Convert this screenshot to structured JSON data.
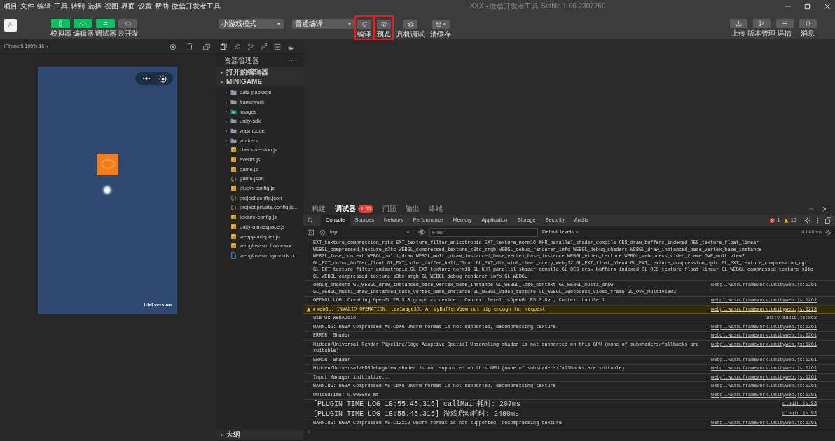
{
  "menu": [
    "项目",
    "文件",
    "编辑",
    "工具",
    "转到",
    "选择",
    "视图",
    "界面",
    "设置",
    "帮助",
    "微信开发者工具"
  ],
  "window": {
    "title": "XXX - 微信开发者工具 Stable 1.06.2307260"
  },
  "toolbar": {
    "view_buttons": [
      {
        "label": "模拟器",
        "kind": "phone",
        "on": true
      },
      {
        "label": "编辑器",
        "kind": "code",
        "on": true
      },
      {
        "label": "调试器",
        "kind": "swap",
        "on": true
      },
      {
        "label": "云开发",
        "kind": "cloud",
        "on": false
      }
    ],
    "mode_select": "小游戏模式",
    "compile_select": "普通编译",
    "actions": [
      {
        "label": "编译",
        "kind": "refresh",
        "highlighted": true
      },
      {
        "label": "预览",
        "kind": "eye",
        "highlighted": true
      },
      {
        "label": "真机调试",
        "kind": "bug",
        "highlighted": false
      },
      {
        "label": "清缓存",
        "kind": "layers",
        "highlighted": false
      }
    ],
    "right_buttons": [
      {
        "label": "上传",
        "kind": "upload"
      },
      {
        "label": "版本管理",
        "kind": "branch"
      },
      {
        "label": "详情",
        "kind": "list"
      },
      {
        "label": "消息",
        "kind": "bell"
      }
    ]
  },
  "simulator": {
    "device": "iPhone 5 100% 16",
    "badge": "trial version"
  },
  "explorer": {
    "title": "资源管理器",
    "more": "···",
    "open_editors": {
      "label": "打开的编辑器",
      "expanded": false
    },
    "project": {
      "label": "MINIGAME",
      "expanded": true,
      "items": [
        {
          "name": "data-package",
          "kind": "folder",
          "expanded": false
        },
        {
          "name": "framework",
          "kind": "folder",
          "expanded": false
        },
        {
          "name": "images",
          "kind": "image-folder",
          "expanded": false
        },
        {
          "name": "unity-sdk",
          "kind": "folder",
          "expanded": false
        },
        {
          "name": "wasmcode",
          "kind": "folder",
          "expanded": false
        },
        {
          "name": "workers",
          "kind": "folder",
          "expanded": false
        },
        {
          "name": "check-version.js",
          "kind": "js"
        },
        {
          "name": "events.js",
          "kind": "js"
        },
        {
          "name": "game.js",
          "kind": "js"
        },
        {
          "name": "game.json",
          "kind": "json"
        },
        {
          "name": "plugin-config.js",
          "kind": "js"
        },
        {
          "name": "project.config.json",
          "kind": "json"
        },
        {
          "name": "project.private.config.js...",
          "kind": "json"
        },
        {
          "name": "texture-config.js",
          "kind": "js"
        },
        {
          "name": "unity-namespace.js",
          "kind": "js"
        },
        {
          "name": "weapp-adapter.js",
          "kind": "js"
        },
        {
          "name": "webgl.wasm.framewor...",
          "kind": "js"
        },
        {
          "name": "webgl.wasm.symbols.u...",
          "kind": "file"
        }
      ]
    },
    "outline": {
      "label": "大纲",
      "expanded": false
    }
  },
  "devtools": {
    "tabs": [
      {
        "label": "构建",
        "selected": false
      },
      {
        "label": "调试器",
        "selected": true,
        "badge": "1, 15"
      },
      {
        "label": "问题",
        "selected": false
      },
      {
        "label": "输出",
        "selected": false
      },
      {
        "label": "终端",
        "selected": false
      }
    ],
    "panels": [
      {
        "label": "Console",
        "selected": true
      },
      {
        "label": "Sources",
        "selected": false
      },
      {
        "label": "Network",
        "selected": false
      },
      {
        "label": "Performance",
        "selected": false
      },
      {
        "label": "Memory",
        "selected": false
      },
      {
        "label": "Application",
        "selected": false
      },
      {
        "label": "Storage",
        "selected": false
      },
      {
        "label": "Security",
        "selected": false
      },
      {
        "label": "Audits",
        "selected": false
      }
    ],
    "errors": "1",
    "warnings": "15",
    "context": "top",
    "filter_placeholder": "Filter",
    "levels": "Default levels",
    "hidden": "4 hidden",
    "logs": [
      {
        "kind": "log",
        "lines": [
          "EXT_texture_compression_rgtc EXT_texture_filter_anisotropic EXT_texture_norm16 KHR_parallel_shader_compile OES_draw_buffers_indexed OES_texture_float_linear",
          "WEBGL_compressed_texture_s3tc WEBGL_compressed_texture_s3tc_srgb WEBGL_debug_renderer_info WEBGL_debug_shaders WEBGL_draw_instanced_base_vertex_base_instance",
          "WEBGL_lose_context WEBGL_multi_draw WEBGL_multi_draw_instanced_base_vertex_base_instance WEBGL_video_texture WEBGL_webcodecs_video_frame OVR_multiview2",
          "GL_EXT_color_buffer_float GL_EXT_color_buffer_half_float GL_EXT_disjoint_timer_query_webgl2 GL_EXT_float_blend GL_EXT_texture_compression_bptc GL_EXT_texture_compression_rgtc",
          "GL_EXT_texture_filter_anisotropic GL_EXT_texture_norm16 GL_KHR_parallel_shader_compile GL_OES_draw_buffers_indexed GL_OES_texture_float_linear GL_WEBGL_compressed_texture_s3tc",
          "GL_WEBGL_compressed_texture_s3tc_srgb GL_WEBGL_debug_renderer_info GL_WEBGL_"
        ]
      },
      {
        "kind": "log",
        "lines": [
          "debug_shaders GL_WEBGL_draw_instanced_base_vertex_base_instance GL_WEBGL_lose_context GL_WEBGL_multi_draw",
          "GL_WEBGL_multi_draw_instanced_base_vertex_base_instance GL_WEBGL_video_texture GL_WEBGL_webcodecs_video_frame GL_OVR_multiview2"
        ],
        "source": "webgl.wasm.framework.unityweb.js:1261"
      },
      {
        "kind": "log",
        "lines": [
          "OPENGL LOG: Creating OpenGL ES 3.0 graphics device ; Context level  <OpenGL ES 3.0> ; Context handle 1"
        ],
        "source": "webgl.wasm.framework.unityweb.js:1261"
      },
      {
        "kind": "warning",
        "lines": [
          "WebGL: INVALID_OPERATION: texImage3D: ArrayBufferView not big enough for request"
        ],
        "source": "webgl.wasm.framework.unityweb.js:1278"
      },
      {
        "kind": "log",
        "lines": [
          "use wx WebAudio"
        ],
        "source": "unity-audio.js:868"
      },
      {
        "kind": "log",
        "lines": [
          "WARNING: RGBA Compressed ASTC6X6 UNorm format is not supported, decompressing texture"
        ],
        "source": "webgl.wasm.framework.unityweb.js:1261"
      },
      {
        "kind": "log",
        "lines": [
          "ERROR: Shader"
        ],
        "source": "webgl.wasm.framework.unityweb.js:1261"
      },
      {
        "kind": "log",
        "lines": [
          "Hidden/Universal Render Pipeline/Edge Adaptive Spatial Upsampling shader is not supported on this GPU (none of subshaders/fallbacks are",
          "suitable)"
        ],
        "source": "webgl.wasm.framework.unityweb.js:1261"
      },
      {
        "kind": "log",
        "lines": [
          "ERROR: Shader"
        ],
        "source": "webgl.wasm.framework.unityweb.js:1261"
      },
      {
        "kind": "log",
        "lines": [
          "Hidden/Universal/HDRDebugView shader is not supported on this GPU (none of subshaders/fallbacks are suitable)"
        ],
        "source": "webgl.wasm.framework.unityweb.js:1261"
      },
      {
        "kind": "log",
        "lines": [
          "Input Manager initialize..."
        ],
        "source": "webgl.wasm.framework.unityweb.js:1261"
      },
      {
        "kind": "log",
        "lines": [
          "WARNING: RGBA Compressed ASTC6X6 UNorm format is not supported, decompressing texture"
        ],
        "source": "webgl.wasm.framework.unityweb.js:1261"
      },
      {
        "kind": "log",
        "lines": [
          "UnloadTime: 0.000000 ms"
        ],
        "source": "webgl.wasm.framework.unityweb.js:1261"
      },
      {
        "kind": "log",
        "lines": [
          "[PLUGIN TIME LOG 18:55.45.316] callMain耗时: 207ms"
        ],
        "source": "plugin.js:93"
      },
      {
        "kind": "log",
        "lines": [
          "[PLUGIN TIME LOG 18:55.45.316] 游戏启动耗时: 2480ms"
        ],
        "source": "plugin.js:93"
      },
      {
        "kind": "log",
        "lines": [
          "WARNING: RGBA Compressed ASTC12X12 UNorm format is not supported, decompressing texture"
        ],
        "source": "webgl.wasm.framework.unityweb.js:1261"
      }
    ]
  }
}
